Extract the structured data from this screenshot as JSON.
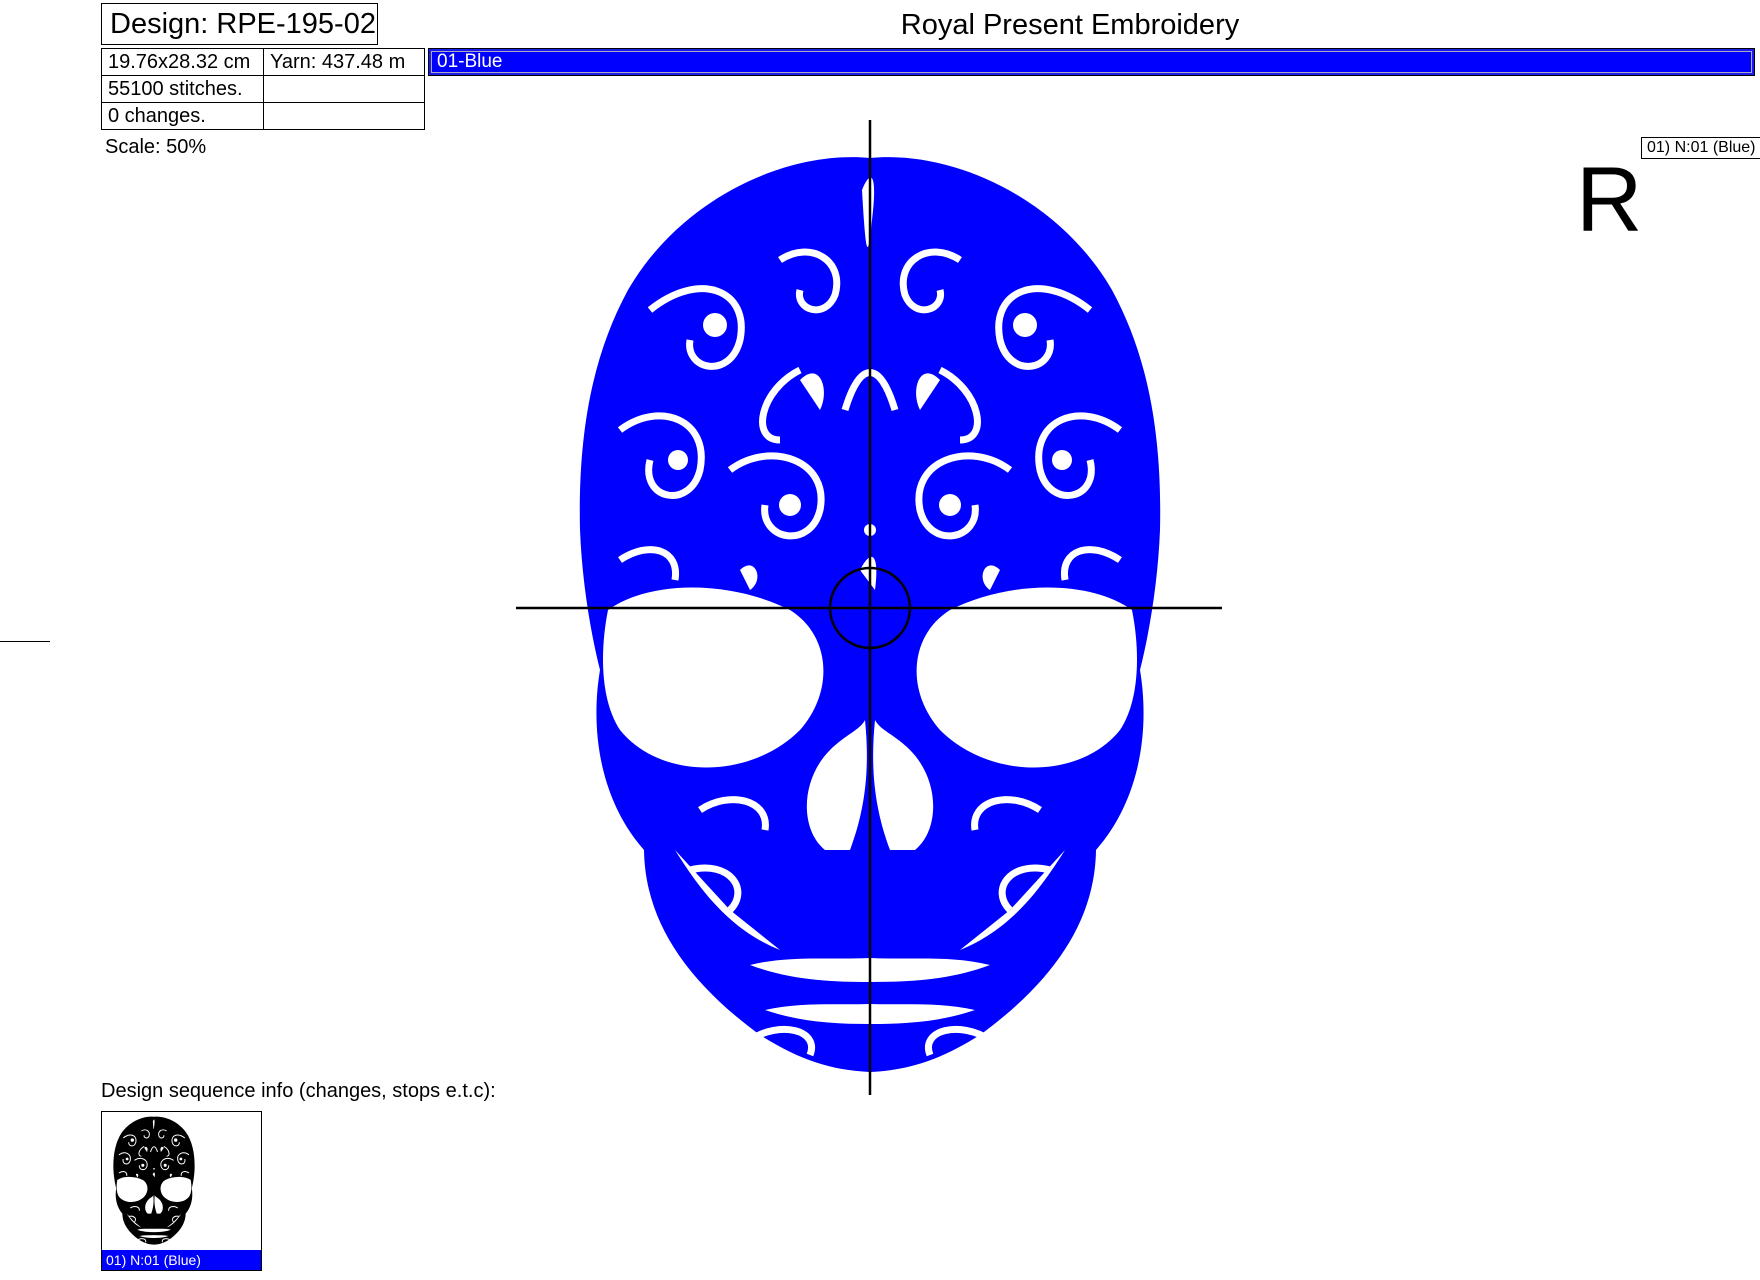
{
  "header": {
    "design_title": "Design: RPE-195-02",
    "company": "Royal Present Embroidery"
  },
  "info": {
    "size": "19.76x28.32 cm",
    "yarn": "Yarn: 437.48 m",
    "stitches": "55100 stitches.",
    "changes": "0 changes."
  },
  "colors": [
    {
      "label": "01-Blue",
      "hex": "#0000ff"
    }
  ],
  "scale": "Scale: 50%",
  "stitch_label": "01) N:01 (Blue)",
  "orientation_mark": "R",
  "sequence": {
    "title": "Design sequence info (changes, stops e.t.c):",
    "items": [
      {
        "label": "01) N:01 (Blue)"
      }
    ]
  },
  "icons": {
    "center_mark": "crosshair-icon",
    "design_preview": "skull-icon"
  }
}
